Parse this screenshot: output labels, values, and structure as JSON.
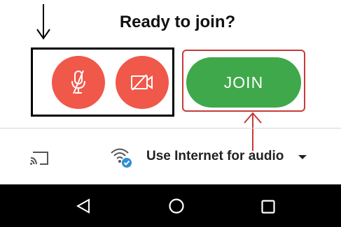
{
  "title": "Ready to join?",
  "join_button": {
    "label": "JOIN"
  },
  "audio": {
    "label": "Use Internet for audio"
  },
  "colors": {
    "mute_button": "#f0584a",
    "video_button": "#f0584a",
    "join_button": "#3fa84a",
    "annotation_red": "#c73a3a",
    "nav_bar": "#000000"
  },
  "icons": {
    "mute": "microphone-off-icon",
    "video": "video-off-icon",
    "cast": "cast-icon",
    "wifi": "wifi-check-icon",
    "audio_dropdown": "caret-down-icon",
    "nav_back": "back-triangle-icon",
    "nav_home": "home-circle-icon",
    "nav_recent": "recent-apps-square-icon"
  }
}
